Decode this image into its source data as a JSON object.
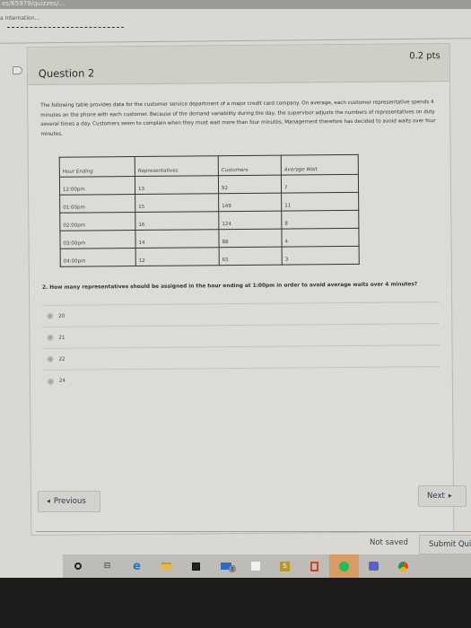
{
  "browser": {
    "url_fragment": "es/65979/quizzes/...",
    "breadcrumb": "a Internation..."
  },
  "question": {
    "title": "Question 2",
    "points": "0.2 pts",
    "intro": "The following table provides data for the customer service department of a major credit card company. On average, each customer representative spends 4 minutes on the phone with each customer. Because of the demand variability during the day, the supervisor adjusts the numbers of representatives on duty several times a day. Customers seem to complain when they must wait more than four minutes. Management therefore has decided to avoid waits over four minutes.",
    "table": {
      "headers": [
        "Hour Ending",
        "Representatives",
        "Customers",
        "Average Wait"
      ],
      "rows": [
        [
          "12:00pm",
          "13",
          "92",
          "7"
        ],
        [
          "01:00pm",
          "15",
          "149",
          "11"
        ],
        [
          "02:00pm",
          "16",
          "124",
          "8"
        ],
        [
          "03:00pm",
          "14",
          "88",
          "4"
        ],
        [
          "04:00pm",
          "12",
          "65",
          "3"
        ]
      ]
    },
    "prompt": "2. How many representatives should be assigned in the hour ending at 1:00pm in order to avoid average waits over 4 minutes?",
    "answers": [
      "20",
      "21",
      "22",
      "24"
    ]
  },
  "nav": {
    "previous": "Previous",
    "next": "Next"
  },
  "footer": {
    "status": "Not saved",
    "submit": "Submit Quiz"
  },
  "taskbar": {
    "icons": [
      "search-icon",
      "task-view-icon",
      "edge-icon",
      "file-explorer-icon",
      "store-icon",
      "mail-icon",
      "app-icon",
      "app-yellow-icon",
      "office-icon",
      "spotify-icon",
      "teams-icon",
      "chrome-icon"
    ],
    "mail_badge": "8"
  }
}
